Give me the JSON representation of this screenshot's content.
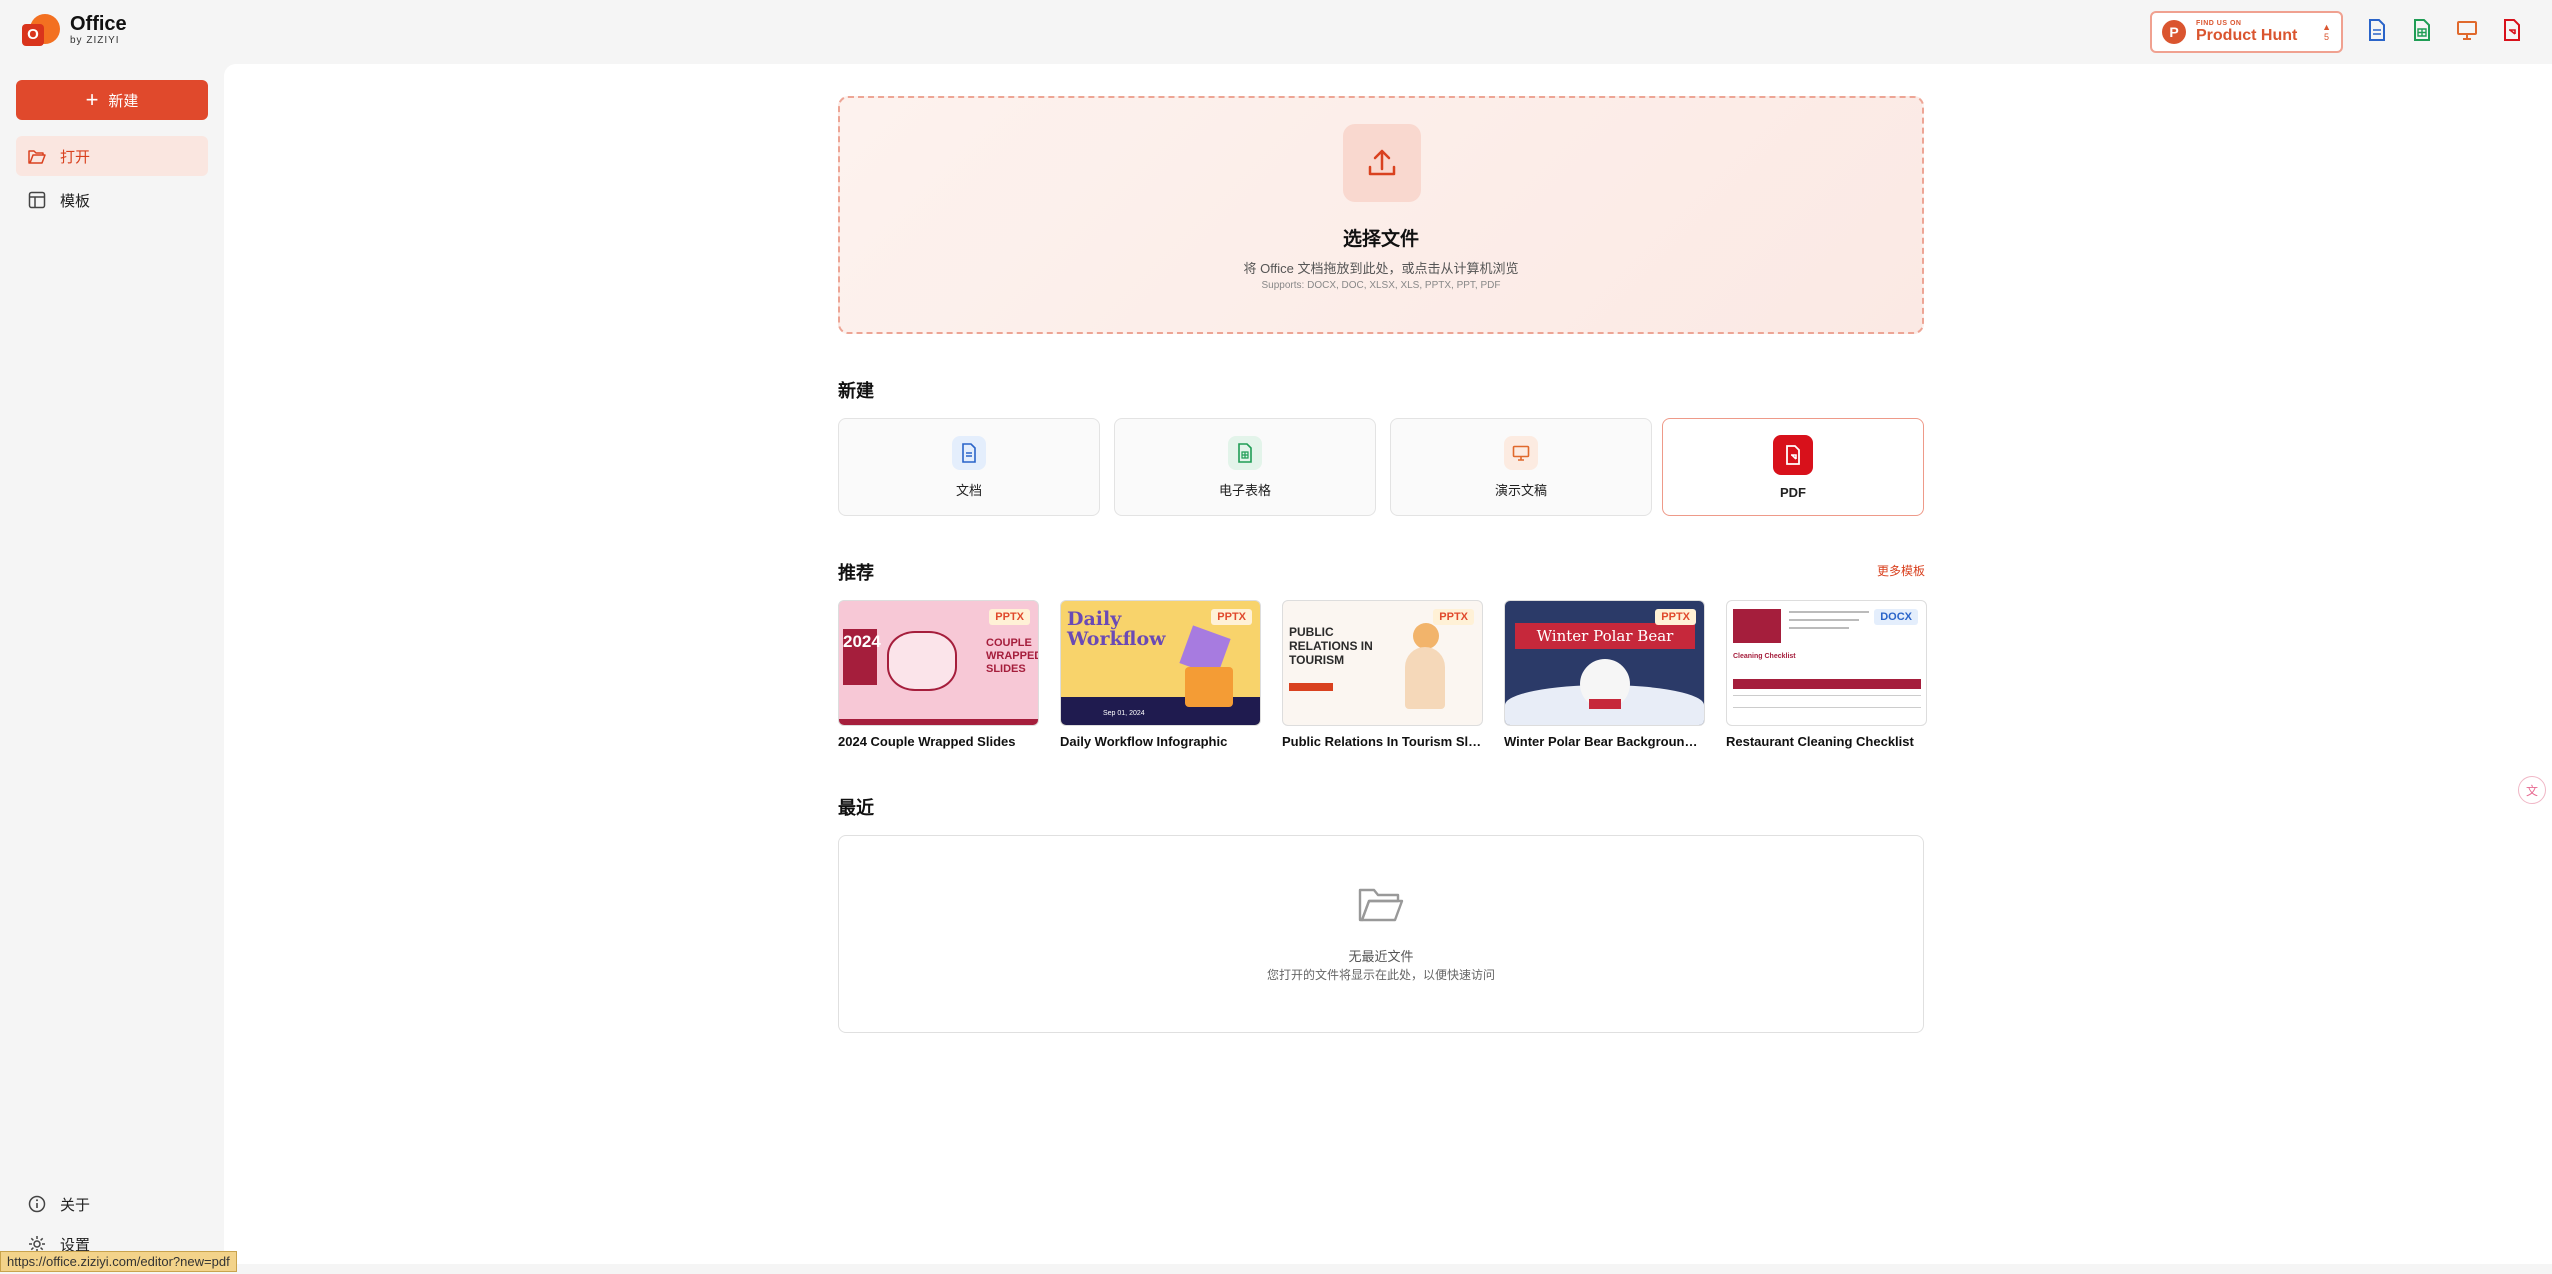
{
  "app": {
    "logo_letter": "O",
    "title": "Office",
    "subtitle": "by ZIZIYI"
  },
  "product_hunt": {
    "small": "FIND US ON",
    "big": "Product Hunt",
    "votes": "5"
  },
  "top_icons": [
    {
      "name": "document-icon",
      "color": "#2a64c9"
    },
    {
      "name": "spreadsheet-icon",
      "color": "#1f9d55"
    },
    {
      "name": "presentation-icon",
      "color": "#e0692c"
    },
    {
      "name": "pdf-icon",
      "color": "#d8111b"
    }
  ],
  "sidebar": {
    "new_label": "新建",
    "items": [
      {
        "label": "打开",
        "icon": "folder-open-icon",
        "active": true
      },
      {
        "label": "模板",
        "icon": "template-icon",
        "active": false
      }
    ],
    "bottom": [
      {
        "label": "关于",
        "icon": "info-icon"
      },
      {
        "label": "设置",
        "icon": "gear-icon"
      }
    ]
  },
  "upload": {
    "title": "选择文件",
    "subtitle": "将 Office 文档拖放到此处，或点击从计算机浏览",
    "supports": "Supports: DOCX, DOC, XLSX, XLS, PPTX, PPT, PDF"
  },
  "new_section": {
    "title": "新建",
    "cards": [
      {
        "label": "文档",
        "icon": "document-icon",
        "color": "#2a64c9"
      },
      {
        "label": "电子表格",
        "icon": "spreadsheet-icon",
        "color": "#1f9d55"
      },
      {
        "label": "演示文稿",
        "icon": "presentation-icon",
        "color": "#e0692c"
      },
      {
        "label": "PDF",
        "icon": "pdf-icon",
        "color": "#d8111b"
      }
    ]
  },
  "recommend": {
    "title": "推荐",
    "more": "更多模板",
    "templates": [
      {
        "name": "2024 Couple Wrapped Slides",
        "badge": "PPTX"
      },
      {
        "name": "Daily Workflow Infographic",
        "badge": "PPTX"
      },
      {
        "name": "Public Relations In Tourism Slides",
        "badge": "PPTX"
      },
      {
        "name": "Winter Polar Bear Background Slides",
        "badge": "PPTX"
      },
      {
        "name": "Restaurant Cleaning Checklist",
        "badge": "DOCX"
      }
    ],
    "thumb_text": {
      "t1_year": "2024",
      "t1_title": "COUPLE WRAPPED SLIDES",
      "t2_title": "Daily Workflow",
      "t2_date": "Sep 01, 2024",
      "t3_title": "PUBLIC RELATIONS IN TOURISM",
      "t4_title": "Winter Polar Bear",
      "t5_title": "Cleaning Checklist"
    }
  },
  "recent": {
    "title": "最近",
    "empty_title": "无最近文件",
    "empty_sub": "您打开的文件将显示在此处，以便快速访问"
  },
  "status_url": "https://office.ziziyi.com/editor?new=pdf"
}
